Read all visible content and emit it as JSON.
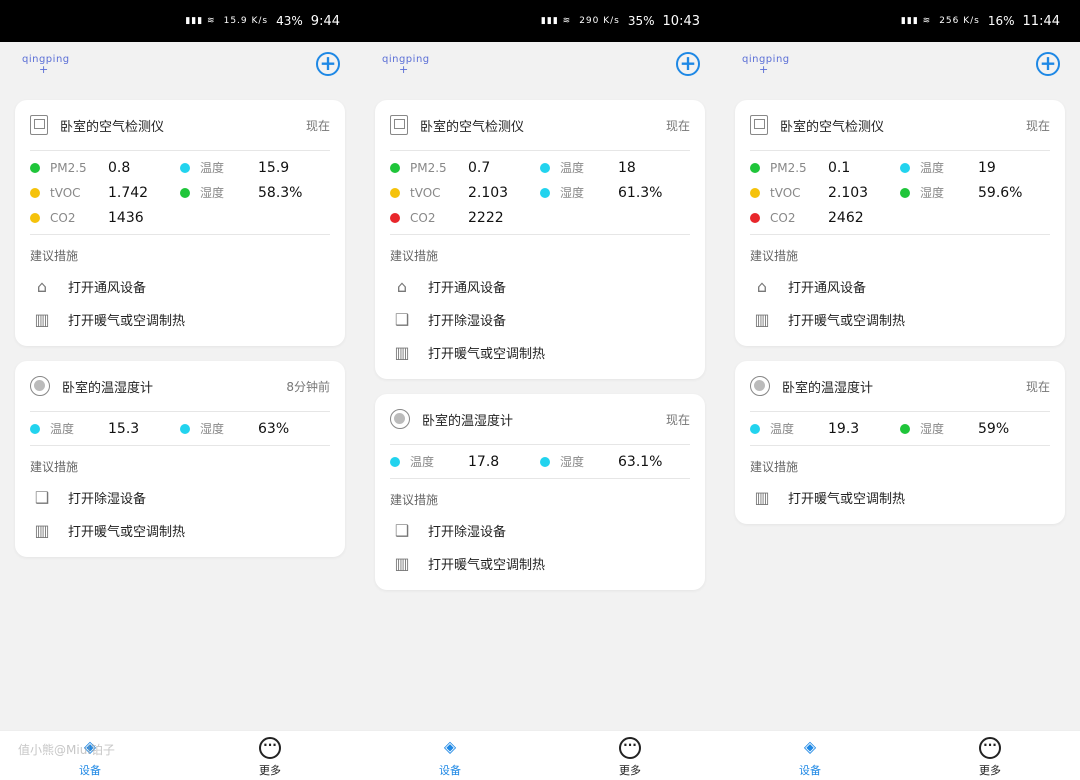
{
  "colors": {
    "green": "#1fc53a",
    "yellow": "#f5c20b",
    "cyan": "#22d3ee",
    "red": "#e8262b",
    "accent": "#1e88e5"
  },
  "app": {
    "logo": "qingping"
  },
  "tabs": [
    {
      "label": "设备"
    },
    {
      "label": "更多"
    }
  ],
  "watermark": "值小熊@MiuI铂子",
  "panels": [
    {
      "status": {
        "net": "15.9 K/s",
        "battery": "43%",
        "time": "9:44"
      },
      "air": {
        "title": "卧室的空气检测仪",
        "time": "现在",
        "metrics": [
          {
            "name": "PM2.5",
            "value": "0.8",
            "color": "#1fc53a"
          },
          {
            "name": "温度",
            "value": "15.9",
            "color": "#22d3ee"
          },
          {
            "name": "tVOC",
            "value": "1.742",
            "color": "#f5c20b"
          },
          {
            "name": "湿度",
            "value": "58.3%",
            "color": "#1fc53a"
          },
          {
            "name": "CO2",
            "value": "1436",
            "color": "#f5c20b"
          }
        ],
        "sugg_title": "建议措施",
        "suggestions": [
          {
            "label": "打开通风设备",
            "icon": "vent-icon"
          },
          {
            "label": "打开暖气或空调制热",
            "icon": "heater-icon"
          }
        ]
      },
      "hygro": {
        "title": "卧室的温湿度计",
        "time": "8分钟前",
        "metrics": [
          {
            "name": "温度",
            "value": "15.3",
            "color": "#22d3ee"
          },
          {
            "name": "湿度",
            "value": "63%",
            "color": "#22d3ee"
          }
        ],
        "sugg_title": "建议措施",
        "suggestions": [
          {
            "label": "打开除湿设备",
            "icon": "dehumidifier-icon"
          },
          {
            "label": "打开暖气或空调制热",
            "icon": "heater-icon"
          }
        ]
      }
    },
    {
      "status": {
        "net": "290 K/s",
        "battery": "35%",
        "time": "10:43"
      },
      "air": {
        "title": "卧室的空气检测仪",
        "time": "现在",
        "metrics": [
          {
            "name": "PM2.5",
            "value": "0.7",
            "color": "#1fc53a"
          },
          {
            "name": "温度",
            "value": "18",
            "color": "#22d3ee"
          },
          {
            "name": "tVOC",
            "value": "2.103",
            "color": "#f5c20b"
          },
          {
            "name": "湿度",
            "value": "61.3%",
            "color": "#22d3ee"
          },
          {
            "name": "CO2",
            "value": "2222",
            "color": "#e8262b"
          }
        ],
        "sugg_title": "建议措施",
        "suggestions": [
          {
            "label": "打开通风设备",
            "icon": "vent-icon"
          },
          {
            "label": "打开除湿设备",
            "icon": "dehumidifier-icon"
          },
          {
            "label": "打开暖气或空调制热",
            "icon": "heater-icon"
          }
        ]
      },
      "hygro": {
        "title": "卧室的温湿度计",
        "time": "现在",
        "metrics": [
          {
            "name": "温度",
            "value": "17.8",
            "color": "#22d3ee"
          },
          {
            "name": "湿度",
            "value": "63.1%",
            "color": "#22d3ee"
          }
        ],
        "sugg_title": "建议措施",
        "suggestions": [
          {
            "label": "打开除湿设备",
            "icon": "dehumidifier-icon"
          },
          {
            "label": "打开暖气或空调制热",
            "icon": "heater-icon"
          }
        ]
      }
    },
    {
      "status": {
        "net": "256 K/s",
        "battery": "16%",
        "time": "11:44"
      },
      "air": {
        "title": "卧室的空气检测仪",
        "time": "现在",
        "metrics": [
          {
            "name": "PM2.5",
            "value": "0.1",
            "color": "#1fc53a"
          },
          {
            "name": "温度",
            "value": "19",
            "color": "#22d3ee"
          },
          {
            "name": "tVOC",
            "value": "2.103",
            "color": "#f5c20b"
          },
          {
            "name": "湿度",
            "value": "59.6%",
            "color": "#1fc53a"
          },
          {
            "name": "CO2",
            "value": "2462",
            "color": "#e8262b"
          }
        ],
        "sugg_title": "建议措施",
        "suggestions": [
          {
            "label": "打开通风设备",
            "icon": "vent-icon"
          },
          {
            "label": "打开暖气或空调制热",
            "icon": "heater-icon"
          }
        ]
      },
      "hygro": {
        "title": "卧室的温湿度计",
        "time": "现在",
        "metrics": [
          {
            "name": "温度",
            "value": "19.3",
            "color": "#22d3ee"
          },
          {
            "name": "湿度",
            "value": "59%",
            "color": "#1fc53a"
          }
        ],
        "sugg_title": "建议措施",
        "suggestions": [
          {
            "label": "打开暖气或空调制热",
            "icon": "heater-icon"
          }
        ]
      }
    }
  ]
}
